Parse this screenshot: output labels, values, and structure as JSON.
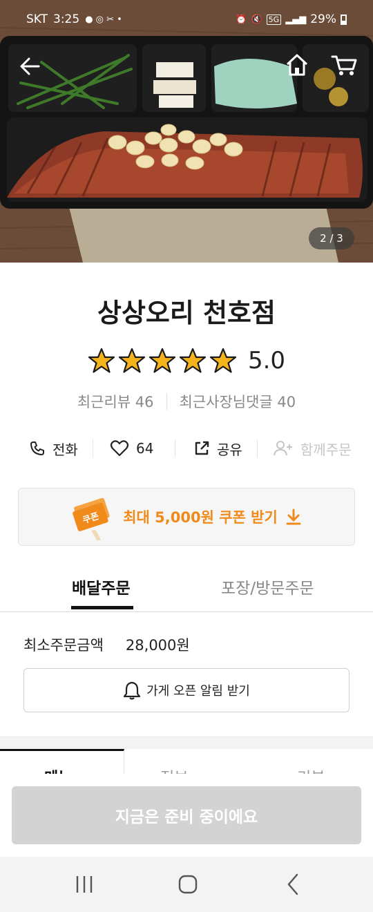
{
  "status_bar": {
    "carrier": "SKT",
    "time": "3:25",
    "network": "5G",
    "battery": "29%"
  },
  "hero": {
    "page_indicator": "2 / 3",
    "icons": [
      "back-arrow-icon",
      "home-icon",
      "cart-icon"
    ]
  },
  "store": {
    "name": "상상오리 천호점",
    "rating": "5.0",
    "stars": 5,
    "recent_reviews": "최근리뷰 46",
    "owner_replies": "최근사장님댓글 40"
  },
  "actions": {
    "call": "전화",
    "likes": "64",
    "share": "공유",
    "group_order": "함께주문"
  },
  "coupon": {
    "tag": "쿠폰",
    "label": "최대 5,000원 쿠폰 받기"
  },
  "order_tabs": {
    "delivery": "배달주문",
    "pickup": "포장/방문주문"
  },
  "order_info": {
    "min_order_label": "최소주문금액",
    "min_order_value": "28,000원",
    "notify_button": "가게 오픈 알림 받기"
  },
  "cta": {
    "label": "지금은 준비 중이에요"
  },
  "colors": {
    "accent": "#f08a1a",
    "star": "#f6b41c",
    "disabled_button": "#d3d3d3"
  }
}
